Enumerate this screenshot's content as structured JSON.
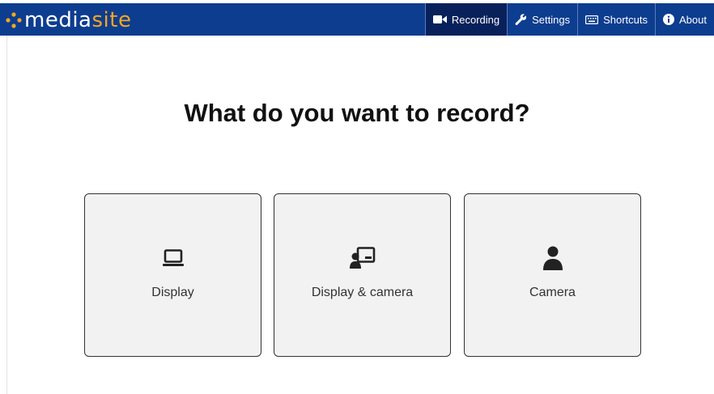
{
  "logo": {
    "text_part1": "media",
    "text_part2": "site"
  },
  "nav": [
    {
      "label": "Recording",
      "icon": "video-camera-icon",
      "active": true
    },
    {
      "label": "Settings",
      "icon": "wrench-icon",
      "active": false
    },
    {
      "label": "Shortcuts",
      "icon": "keyboard-icon",
      "active": false
    },
    {
      "label": "About",
      "icon": "info-icon",
      "active": false
    }
  ],
  "main": {
    "title": "What do you want to record?",
    "options": [
      {
        "label": "Display",
        "icon": "laptop-icon"
      },
      {
        "label": "Display & camera",
        "icon": "presenter-screen-icon"
      },
      {
        "label": "Camera",
        "icon": "person-icon"
      }
    ]
  },
  "colors": {
    "header_bg": "#0d3d8f",
    "active_nav_bg": "#08215a",
    "logo_accent": "#f5a623",
    "card_bg": "#f2f2f2"
  }
}
